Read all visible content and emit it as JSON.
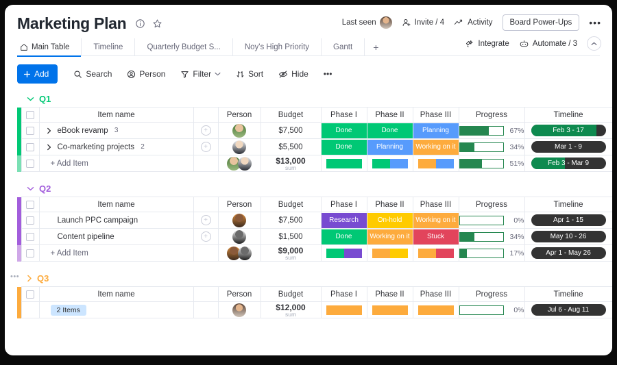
{
  "header": {
    "title": "Marketing Plan",
    "last_seen_label": "Last seen",
    "invite_label": "Invite / 4",
    "activity_label": "Activity",
    "power_ups_label": "Board Power-Ups",
    "more_label": "•••",
    "integrate_label": "Integrate",
    "automate_label": "Automate / 3"
  },
  "tabs": [
    {
      "label": "Main Table",
      "active": true
    },
    {
      "label": "Timeline",
      "active": false
    },
    {
      "label": "Quarterly Budget S...",
      "active": false
    },
    {
      "label": "Noy's High Priority",
      "active": false
    },
    {
      "label": "Gantt",
      "active": false
    }
  ],
  "tab_add_label": "+",
  "toolbar": {
    "add_label": "Add",
    "search_label": "Search",
    "person_label": "Person",
    "filter_label": "Filter",
    "sort_label": "Sort",
    "hide_label": "Hide",
    "more_label": "•••"
  },
  "columns": {
    "item_name": "Item name",
    "person": "Person",
    "budget": "Budget",
    "phase1": "Phase I",
    "phase2": "Phase II",
    "phase3": "Phase III",
    "progress": "Progress",
    "timeline": "Timeline"
  },
  "add_item_label": "+ Add Item",
  "sum_label": "sum",
  "colors": {
    "q1": "#00c875",
    "q2": "#a25ddc",
    "q3": "#fdab3d",
    "done": "#00c875",
    "planning": "#579bfc",
    "working": "#fdab3d",
    "stuck": "#e2445c",
    "on_hold": "#ffcb00",
    "research": "#784bd1",
    "progress_green": "#258750",
    "timeline_dark": "#333333",
    "timeline_green": "#0e8a4f",
    "accent_blue": "#0073ea"
  },
  "groups": [
    {
      "name": "Q1",
      "color": "#00c875",
      "collapsed": false,
      "rows": [
        {
          "name": "eBook revamp",
          "subitems": "3",
          "budget": "$7,500",
          "phase1": {
            "label": "Done",
            "color": "#00c875"
          },
          "phase2": {
            "label": "Done",
            "color": "#00c875"
          },
          "phase3": {
            "label": "Planning",
            "color": "#579bfc"
          },
          "progress": 67,
          "progress_label": "67%",
          "timeline": "Feb 3 - 17",
          "timeline_fill": 88
        },
        {
          "name": "Co-marketing projects",
          "subitems": "2",
          "budget": "$5,500",
          "phase1": {
            "label": "Done",
            "color": "#00c875"
          },
          "phase2": {
            "label": "Planning",
            "color": "#579bfc"
          },
          "phase3": {
            "label": "Working on it",
            "color": "#fdab3d"
          },
          "progress": 34,
          "progress_label": "34%",
          "timeline": "Mar 1 - 9",
          "timeline_fill": 0
        }
      ],
      "summary": {
        "budget": "$13,000",
        "phase1_segments": [
          {
            "color": "#00c875",
            "pct": 100
          }
        ],
        "phase2_segments": [
          {
            "color": "#00c875",
            "pct": 50
          },
          {
            "color": "#579bfc",
            "pct": 50
          }
        ],
        "phase3_segments": [
          {
            "color": "#fdab3d",
            "pct": 50
          },
          {
            "color": "#579bfc",
            "pct": 50
          }
        ],
        "progress": 51,
        "progress_label": "51%",
        "timeline": "Feb 3 - Mar 9",
        "timeline_fill": 45
      }
    },
    {
      "name": "Q2",
      "color": "#a25ddc",
      "collapsed": false,
      "rows": [
        {
          "name": "Launch PPC campaign",
          "subitems": "",
          "budget": "$7,500",
          "phase1": {
            "label": "Research",
            "color": "#784bd1"
          },
          "phase2": {
            "label": "On-hold",
            "color": "#ffcb00"
          },
          "phase3": {
            "label": "Working on it",
            "color": "#fdab3d"
          },
          "progress": 0,
          "progress_label": "0%",
          "timeline": "Apr 1 - 15",
          "timeline_fill": 0
        },
        {
          "name": "Content pipeline",
          "subitems": "",
          "budget": "$1,500",
          "phase1": {
            "label": "Done",
            "color": "#00c875"
          },
          "phase2": {
            "label": "Working on it",
            "color": "#fdab3d"
          },
          "phase3": {
            "label": "Stuck",
            "color": "#e2445c"
          },
          "progress": 34,
          "progress_label": "34%",
          "timeline": "May 10 - 26",
          "timeline_fill": 0
        }
      ],
      "summary": {
        "budget": "$9,000",
        "phase1_segments": [
          {
            "color": "#00c875",
            "pct": 50
          },
          {
            "color": "#784bd1",
            "pct": 50
          }
        ],
        "phase2_segments": [
          {
            "color": "#fdab3d",
            "pct": 50
          },
          {
            "color": "#ffcb00",
            "pct": 50
          }
        ],
        "phase3_segments": [
          {
            "color": "#fdab3d",
            "pct": 50
          },
          {
            "color": "#e2445c",
            "pct": 50
          }
        ],
        "progress": 17,
        "progress_label": "17%",
        "timeline": "Apr 1 - May 26",
        "timeline_fill": 0
      }
    },
    {
      "name": "Q3",
      "color": "#fdab3d",
      "collapsed": true,
      "items_badge": "2 Items",
      "summary": {
        "budget": "$12,000",
        "phase1_segments": [
          {
            "color": "#fdab3d",
            "pct": 100
          }
        ],
        "phase2_segments": [
          {
            "color": "#fdab3d",
            "pct": 100
          }
        ],
        "phase3_segments": [
          {
            "color": "#fdab3d",
            "pct": 100
          }
        ],
        "progress": 0,
        "progress_label": "0%",
        "timeline": "Jul 6 - Aug 11",
        "timeline_fill": 0
      }
    }
  ]
}
